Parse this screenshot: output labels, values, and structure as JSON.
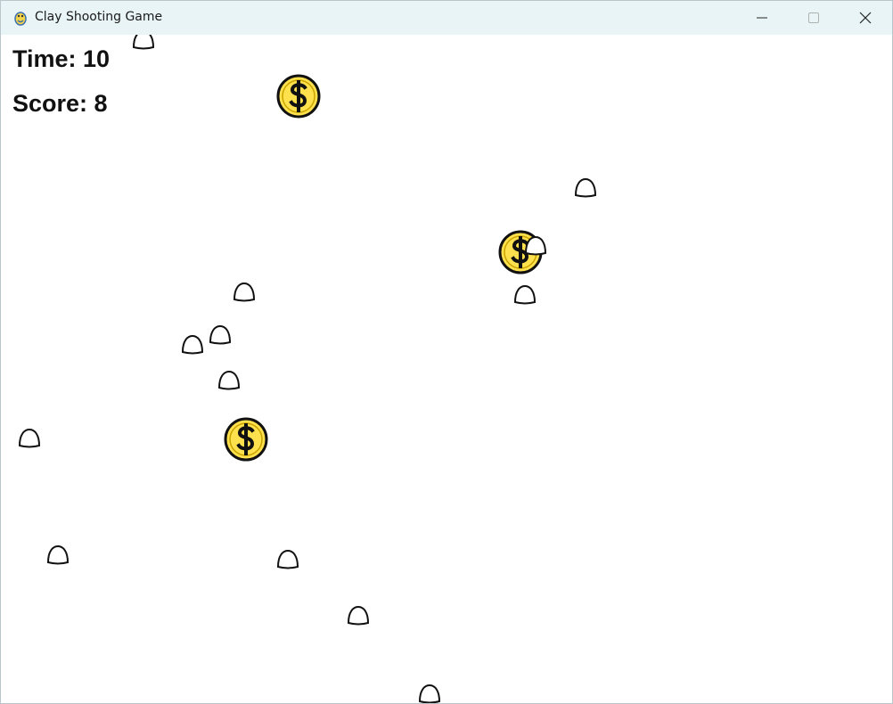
{
  "window": {
    "title": "Clay Shooting Game",
    "app_icon": "pygame-snake-icon",
    "controls": [
      "minimize-icon",
      "maximize-icon",
      "close-icon"
    ]
  },
  "hud": {
    "time_text": "Time: 10",
    "score_text": "Score: 8"
  },
  "sprites": {
    "clay_target": {
      "icon": "clay-pigeon-icon",
      "fill": "#ffffff",
      "stroke": "#111111"
    },
    "coin": {
      "icon": "dollar-coin-icon",
      "fill": "#ffe14d",
      "stroke": "#111111"
    }
  },
  "colors": {
    "titlebar": "#e9f4f6",
    "background": "#ffffff",
    "text": "#111111"
  }
}
